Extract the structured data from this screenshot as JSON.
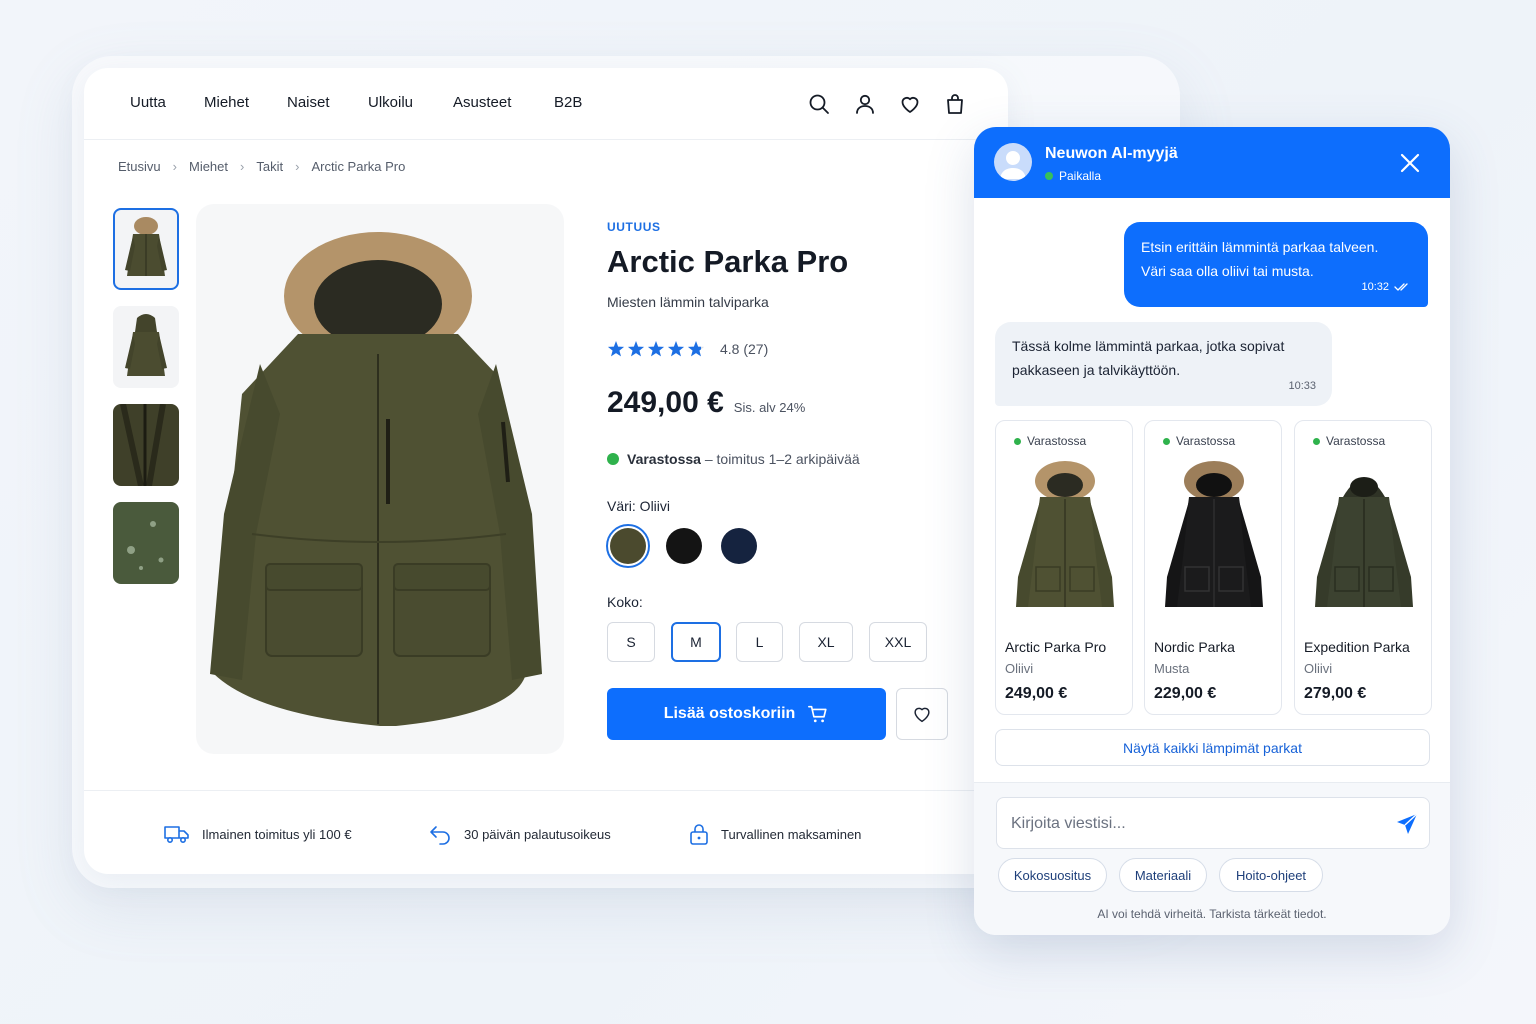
{
  "nav": {
    "items": [
      "Uutta",
      "Miehet",
      "Naiset",
      "Ulkoilu",
      "Asusteet",
      "B2B"
    ]
  },
  "icons": {
    "search": "search-icon",
    "account": "user-icon",
    "wishlist": "heart-icon",
    "bag": "shopping-bag-icon"
  },
  "breadcrumb": [
    "Etusivu",
    "Miehet",
    "Takit",
    "Arctic Parka Pro"
  ],
  "product": {
    "badge": "UUTUUS",
    "title": "Arctic Parka Pro",
    "subtitle": "Miesten lämmin talviparka",
    "rating": 4.8,
    "rating_text": "4.8 (27)",
    "price": "249,00 €",
    "vat": "Sis. alv 24%",
    "stock_strong": "Varastossa",
    "stock_rest": "– toimitus 1–2 arkipäivää",
    "color_label": "Väri: Oliivi",
    "colors": [
      "#4b4a2e",
      "#141414",
      "#15233f"
    ],
    "size_label": "Koko:",
    "sizes": [
      "S",
      "M",
      "L",
      "XL",
      "XXL"
    ],
    "selected_size": "M",
    "add_to_cart": "Lisää ostoskoriin"
  },
  "features": [
    "Ilmainen toimitus yli 100 €",
    "30 päivän palautusoikeus",
    "Turvallinen maksaminen"
  ],
  "chat": {
    "title": "Neuwon AI-myyjä",
    "status": "Paikalla",
    "user_msg_line1": "Etsin erittäin lämmintä parkaa talveen.",
    "user_msg_line2": "Väri saa olla oliivi tai musta.",
    "user_time": "10:32",
    "bot_msg_line1": "Tässä kolme lämmintä parkaa, jotka sopivat",
    "bot_msg_line2": "pakkaseen ja talvikäyttöön.",
    "bot_time": "10:33",
    "products": [
      {
        "stock": "Varastossa",
        "name": "Arctic Parka Pro",
        "color": "Oliivi",
        "price": "249,00 €"
      },
      {
        "stock": "Varastossa",
        "name": "Nordic Parka",
        "color": "Musta",
        "price": "229,00 €"
      },
      {
        "stock": "Varastossa",
        "name": "Expedition Parka",
        "color": "Oliivi",
        "price": "279,00 €"
      }
    ],
    "show_all": "Näytä kaikki lämpimät parkat",
    "input_placeholder": "Kirjoita viestisi...",
    "chips": [
      "Kokosuositus",
      "Materiaali",
      "Hoito-ohjeet"
    ],
    "disclaimer": "AI voi tehdä virheitä. Tarkista tärkeät tiedot."
  },
  "colors": {
    "accent": "#0d6efd",
    "in_stock": "#2fb24c",
    "star": "#1d6fe3"
  }
}
